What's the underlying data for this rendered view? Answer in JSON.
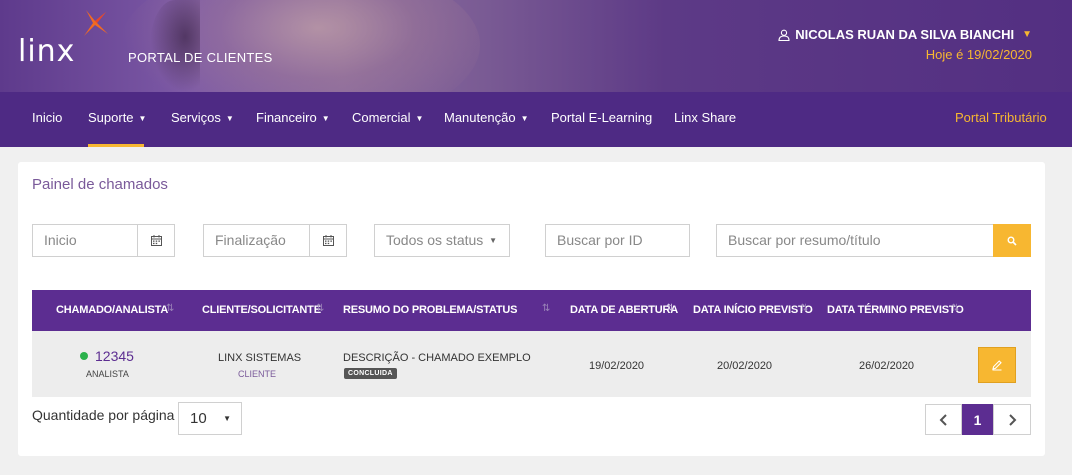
{
  "header": {
    "logo_text": "linx",
    "portal_title": "PORTAL DE CLIENTES",
    "user_name": "NICOLAS RUAN DA SILVA BIANCHI",
    "today": "Hoje é 19/02/2020"
  },
  "nav": {
    "items": [
      {
        "label": "Inicio"
      },
      {
        "label": "Suporte"
      },
      {
        "label": "Serviços"
      },
      {
        "label": "Financeiro"
      },
      {
        "label": "Comercial"
      },
      {
        "label": "Manutenção"
      },
      {
        "label": "Portal E-Learning"
      },
      {
        "label": "Linx Share"
      }
    ],
    "right_item": "Portal Tributário"
  },
  "panel": {
    "title": "Painel de chamados",
    "filters": {
      "start_placeholder": "Inicio",
      "end_placeholder": "Finalização",
      "status_value": "Todos os status",
      "id_placeholder": "Buscar por ID",
      "summary_placeholder": "Buscar por resumo/título"
    },
    "table": {
      "headers": [
        "CHAMADO/ANALISTA",
        "CLIENTE/SOLICITANTE",
        "RESUMO DO PROBLEMA/STATUS",
        "DATA DE ABERTURA",
        "DATA INÍCIO PREVISTO",
        "DATA TÉRMINO PREVISTO"
      ],
      "rows": [
        {
          "id": "12345",
          "analyst": "ANALISTA",
          "client": "LINX SISTEMAS",
          "requester": "CLIENTE",
          "summary": "DESCRIÇÃO - CHAMADO EXEMPLO",
          "status": "CONCLUIDA",
          "opened": "19/02/2020",
          "start": "20/02/2020",
          "end": "26/02/2020"
        }
      ]
    },
    "pagination": {
      "qty_label": "Quantidade por página",
      "qty_value": "10",
      "current_page": "1"
    }
  },
  "colors": {
    "brand_purple": "#5c2d91",
    "accent_yellow": "#f7b731",
    "status_green": "#2bb24c"
  }
}
